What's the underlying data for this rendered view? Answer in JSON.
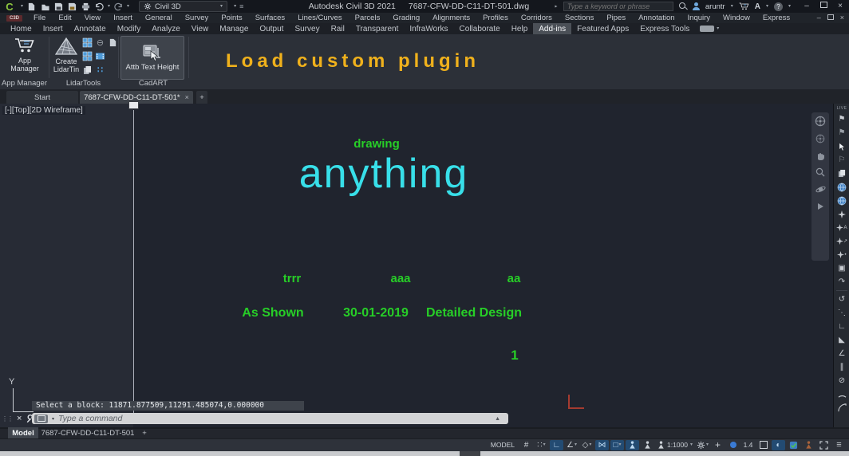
{
  "title_bar": {
    "workspace": "Civil 3D",
    "app_title": "Autodesk Civil 3D 2021",
    "doc_title": "7687-CFW-DD-C11-DT-501.dwg",
    "search_placeholder": "Type a keyword or phrase",
    "username": "aruntr"
  },
  "menu_bar": {
    "badge": "C3D",
    "items": [
      "File",
      "Edit",
      "View",
      "Insert",
      "General",
      "Survey",
      "Points",
      "Surfaces",
      "Lines/Curves",
      "Parcels",
      "Grading",
      "Alignments",
      "Profiles",
      "Corridors",
      "Sections",
      "Pipes",
      "Annotation",
      "Inquiry",
      "Window",
      "Express"
    ]
  },
  "ribbon_tabs": {
    "items": [
      "Home",
      "Insert",
      "Annotate",
      "Modify",
      "Analyze",
      "View",
      "Manage",
      "Output",
      "Survey",
      "Rail",
      "Transparent",
      "InfraWorks",
      "Collaborate",
      "Help",
      "Add-ins",
      "Featured Apps",
      "Express Tools"
    ],
    "active": "Add-ins"
  },
  "ribbon_panels": {
    "app_manager": {
      "button": "App Manager",
      "panel": "App Manager"
    },
    "lidartools": {
      "button_line1": "Create",
      "button_line2": "LidarTin",
      "panel": "LidarTools"
    },
    "cadart": {
      "button": "Attb Text Height",
      "panel": "CadART"
    }
  },
  "overlay": {
    "text": "Load custom plugin",
    "color": "#f0b11c"
  },
  "doc_tabs": {
    "start": "Start",
    "active": "7687-CFW-DD-C11-DT-501*",
    "new_tab": "+"
  },
  "viewport": {
    "controls": "[-][Top][2D Wireframe]",
    "ucs_axis_y": "Y",
    "annotations": {
      "label_small": "drawing",
      "label_large": "anything",
      "field1": "trrr",
      "field2": "aaa",
      "field3": "aa",
      "value1": "As Shown",
      "value2": "30-01-2019",
      "value3": "Detailed Design",
      "sheet_number": "1"
    },
    "colors": {
      "green": "#27ce27",
      "cyan": "#38dfe9"
    }
  },
  "command_line": {
    "history": "Select a block: 11871.877509,11291.485074,0.000000",
    "prompt": "Type a command"
  },
  "layout_tabs": {
    "model": "Model",
    "layout": "7687-CFW-DD-C11-DT-501",
    "new_layout": "+"
  },
  "status_bar": {
    "model": "MODEL",
    "scale": "1:1000",
    "lod": "1.4"
  },
  "right_toolbar": {
    "badge": "LIVE"
  }
}
